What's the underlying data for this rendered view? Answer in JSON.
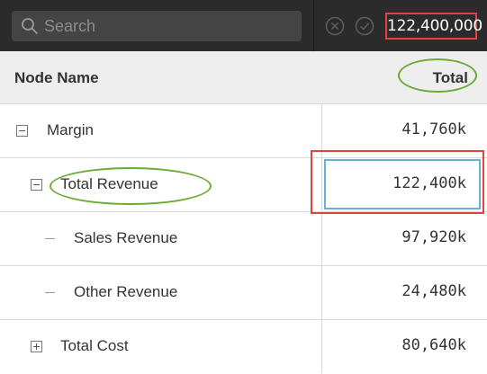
{
  "toolbar": {
    "search_placeholder": "Search",
    "value_field": "122,400,000",
    "icons": [
      "search-icon",
      "cancel-icon",
      "confirm-icon"
    ]
  },
  "columns": {
    "name": "Node Name",
    "total": "Total"
  },
  "rows": [
    {
      "label": "Margin",
      "value": "41,760k",
      "toggle": "collapse"
    },
    {
      "label": "Total Revenue",
      "value": "122,400k",
      "toggle": "collapse",
      "selected": true
    },
    {
      "label": "Sales Revenue",
      "value": "97,920k",
      "toggle": "leaf"
    },
    {
      "label": "Other Revenue",
      "value": "24,480k",
      "toggle": "leaf"
    },
    {
      "label": "Total Cost",
      "value": "80,640k",
      "toggle": "expand"
    }
  ],
  "colors": {
    "toolbar_bg": "#2b2b2b",
    "highlight_red": "#e0443e",
    "highlight_green": "#6cab35",
    "selection_blue": "#6aaedb"
  }
}
